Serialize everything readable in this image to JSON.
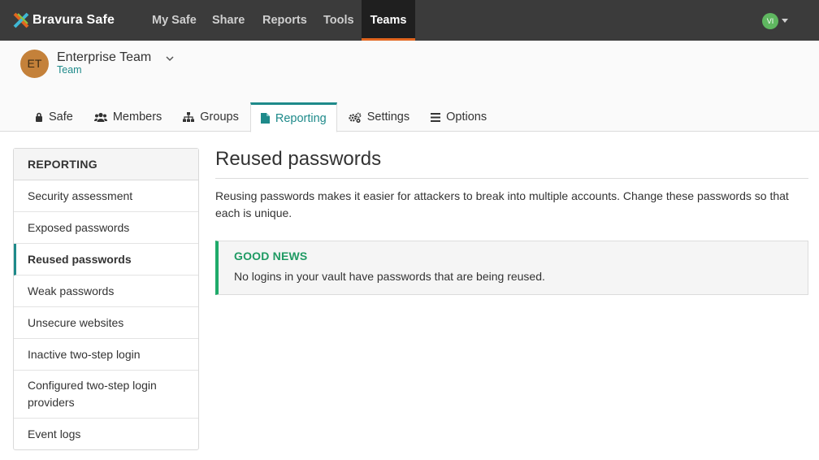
{
  "navbar": {
    "brand": "Bravura Safe",
    "items": [
      "My Safe",
      "Share",
      "Reports",
      "Tools",
      "Teams"
    ],
    "active_item": "Teams",
    "user_initials": "VI"
  },
  "org": {
    "initials": "ET",
    "name": "Enterprise Team",
    "type": "Team"
  },
  "tabs": [
    "Safe",
    "Members",
    "Groups",
    "Reporting",
    "Settings",
    "Options"
  ],
  "sidebar": {
    "heading": "REPORTING",
    "items": [
      "Security assessment",
      "Exposed passwords",
      "Reused passwords",
      "Weak passwords",
      "Unsecure websites",
      "Inactive two-step login",
      "Configured two-step login providers",
      "Event logs"
    ]
  },
  "main": {
    "title": "Reused passwords",
    "description": "Reusing passwords makes it easier for attackers to break into multiple accounts. Change these passwords so that each is unique.",
    "callout": {
      "title": "GOOD NEWS",
      "body": "No logins in your vault have passwords that are being reused."
    }
  },
  "colors": {
    "navbar_bg": "#3b3b3b",
    "active_accent": "#e2661f",
    "teal": "#1e8a8a",
    "success": "#1faa6a"
  }
}
